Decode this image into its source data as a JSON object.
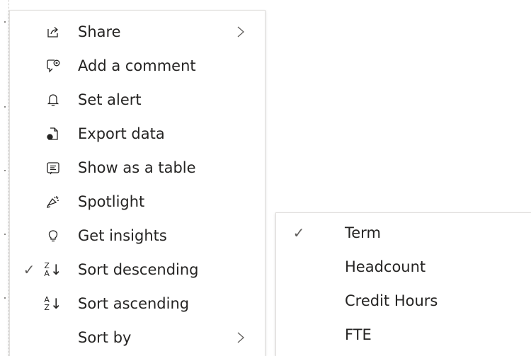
{
  "context_menu": {
    "items": [
      {
        "label": "Share",
        "icon": "share-icon",
        "has_submenu": true,
        "checked": false
      },
      {
        "label": "Add a comment",
        "icon": "comment-icon",
        "has_submenu": false,
        "checked": false
      },
      {
        "label": "Set alert",
        "icon": "bell-icon",
        "has_submenu": false,
        "checked": false
      },
      {
        "label": "Export data",
        "icon": "export-data-icon",
        "has_submenu": false,
        "checked": false
      },
      {
        "label": "Show as a table",
        "icon": "table-icon",
        "has_submenu": false,
        "checked": false
      },
      {
        "label": "Spotlight",
        "icon": "spotlight-icon",
        "has_submenu": false,
        "checked": false
      },
      {
        "label": "Get insights",
        "icon": "lightbulb-icon",
        "has_submenu": false,
        "checked": false
      },
      {
        "label": "Sort descending",
        "icon": "sort-descending-icon",
        "has_submenu": false,
        "checked": true
      },
      {
        "label": "Sort ascending",
        "icon": "sort-ascending-icon",
        "has_submenu": false,
        "checked": false
      },
      {
        "label": "Sort by",
        "icon": "",
        "has_submenu": true,
        "checked": false
      }
    ]
  },
  "sort_by_submenu": {
    "items": [
      {
        "label": "Term",
        "checked": true
      },
      {
        "label": "Headcount",
        "checked": false
      },
      {
        "label": "Credit Hours",
        "checked": false
      },
      {
        "label": "FTE",
        "checked": false
      }
    ]
  },
  "glyphs": {
    "check": "✓",
    "sort_desc_top": "Z",
    "sort_desc_bottom": "A",
    "sort_asc_top": "A",
    "sort_asc_bottom": "Z",
    "down_arrow": "↓"
  }
}
